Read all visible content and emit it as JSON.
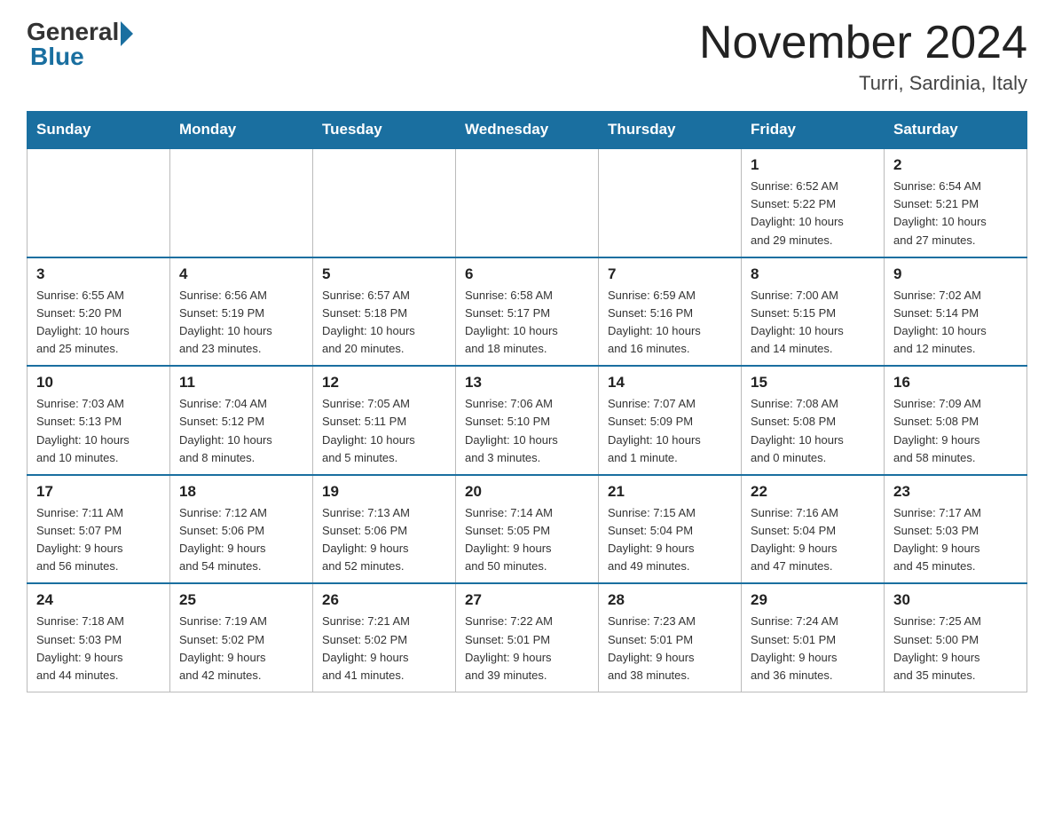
{
  "header": {
    "logo_general": "General",
    "logo_blue": "Blue",
    "month_title": "November 2024",
    "location": "Turri, Sardinia, Italy"
  },
  "days_of_week": [
    "Sunday",
    "Monday",
    "Tuesday",
    "Wednesday",
    "Thursday",
    "Friday",
    "Saturday"
  ],
  "weeks": [
    [
      {
        "day": "",
        "info": ""
      },
      {
        "day": "",
        "info": ""
      },
      {
        "day": "",
        "info": ""
      },
      {
        "day": "",
        "info": ""
      },
      {
        "day": "",
        "info": ""
      },
      {
        "day": "1",
        "info": "Sunrise: 6:52 AM\nSunset: 5:22 PM\nDaylight: 10 hours\nand 29 minutes."
      },
      {
        "day": "2",
        "info": "Sunrise: 6:54 AM\nSunset: 5:21 PM\nDaylight: 10 hours\nand 27 minutes."
      }
    ],
    [
      {
        "day": "3",
        "info": "Sunrise: 6:55 AM\nSunset: 5:20 PM\nDaylight: 10 hours\nand 25 minutes."
      },
      {
        "day": "4",
        "info": "Sunrise: 6:56 AM\nSunset: 5:19 PM\nDaylight: 10 hours\nand 23 minutes."
      },
      {
        "day": "5",
        "info": "Sunrise: 6:57 AM\nSunset: 5:18 PM\nDaylight: 10 hours\nand 20 minutes."
      },
      {
        "day": "6",
        "info": "Sunrise: 6:58 AM\nSunset: 5:17 PM\nDaylight: 10 hours\nand 18 minutes."
      },
      {
        "day": "7",
        "info": "Sunrise: 6:59 AM\nSunset: 5:16 PM\nDaylight: 10 hours\nand 16 minutes."
      },
      {
        "day": "8",
        "info": "Sunrise: 7:00 AM\nSunset: 5:15 PM\nDaylight: 10 hours\nand 14 minutes."
      },
      {
        "day": "9",
        "info": "Sunrise: 7:02 AM\nSunset: 5:14 PM\nDaylight: 10 hours\nand 12 minutes."
      }
    ],
    [
      {
        "day": "10",
        "info": "Sunrise: 7:03 AM\nSunset: 5:13 PM\nDaylight: 10 hours\nand 10 minutes."
      },
      {
        "day": "11",
        "info": "Sunrise: 7:04 AM\nSunset: 5:12 PM\nDaylight: 10 hours\nand 8 minutes."
      },
      {
        "day": "12",
        "info": "Sunrise: 7:05 AM\nSunset: 5:11 PM\nDaylight: 10 hours\nand 5 minutes."
      },
      {
        "day": "13",
        "info": "Sunrise: 7:06 AM\nSunset: 5:10 PM\nDaylight: 10 hours\nand 3 minutes."
      },
      {
        "day": "14",
        "info": "Sunrise: 7:07 AM\nSunset: 5:09 PM\nDaylight: 10 hours\nand 1 minute."
      },
      {
        "day": "15",
        "info": "Sunrise: 7:08 AM\nSunset: 5:08 PM\nDaylight: 10 hours\nand 0 minutes."
      },
      {
        "day": "16",
        "info": "Sunrise: 7:09 AM\nSunset: 5:08 PM\nDaylight: 9 hours\nand 58 minutes."
      }
    ],
    [
      {
        "day": "17",
        "info": "Sunrise: 7:11 AM\nSunset: 5:07 PM\nDaylight: 9 hours\nand 56 minutes."
      },
      {
        "day": "18",
        "info": "Sunrise: 7:12 AM\nSunset: 5:06 PM\nDaylight: 9 hours\nand 54 minutes."
      },
      {
        "day": "19",
        "info": "Sunrise: 7:13 AM\nSunset: 5:06 PM\nDaylight: 9 hours\nand 52 minutes."
      },
      {
        "day": "20",
        "info": "Sunrise: 7:14 AM\nSunset: 5:05 PM\nDaylight: 9 hours\nand 50 minutes."
      },
      {
        "day": "21",
        "info": "Sunrise: 7:15 AM\nSunset: 5:04 PM\nDaylight: 9 hours\nand 49 minutes."
      },
      {
        "day": "22",
        "info": "Sunrise: 7:16 AM\nSunset: 5:04 PM\nDaylight: 9 hours\nand 47 minutes."
      },
      {
        "day": "23",
        "info": "Sunrise: 7:17 AM\nSunset: 5:03 PM\nDaylight: 9 hours\nand 45 minutes."
      }
    ],
    [
      {
        "day": "24",
        "info": "Sunrise: 7:18 AM\nSunset: 5:03 PM\nDaylight: 9 hours\nand 44 minutes."
      },
      {
        "day": "25",
        "info": "Sunrise: 7:19 AM\nSunset: 5:02 PM\nDaylight: 9 hours\nand 42 minutes."
      },
      {
        "day": "26",
        "info": "Sunrise: 7:21 AM\nSunset: 5:02 PM\nDaylight: 9 hours\nand 41 minutes."
      },
      {
        "day": "27",
        "info": "Sunrise: 7:22 AM\nSunset: 5:01 PM\nDaylight: 9 hours\nand 39 minutes."
      },
      {
        "day": "28",
        "info": "Sunrise: 7:23 AM\nSunset: 5:01 PM\nDaylight: 9 hours\nand 38 minutes."
      },
      {
        "day": "29",
        "info": "Sunrise: 7:24 AM\nSunset: 5:01 PM\nDaylight: 9 hours\nand 36 minutes."
      },
      {
        "day": "30",
        "info": "Sunrise: 7:25 AM\nSunset: 5:00 PM\nDaylight: 9 hours\nand 35 minutes."
      }
    ]
  ]
}
